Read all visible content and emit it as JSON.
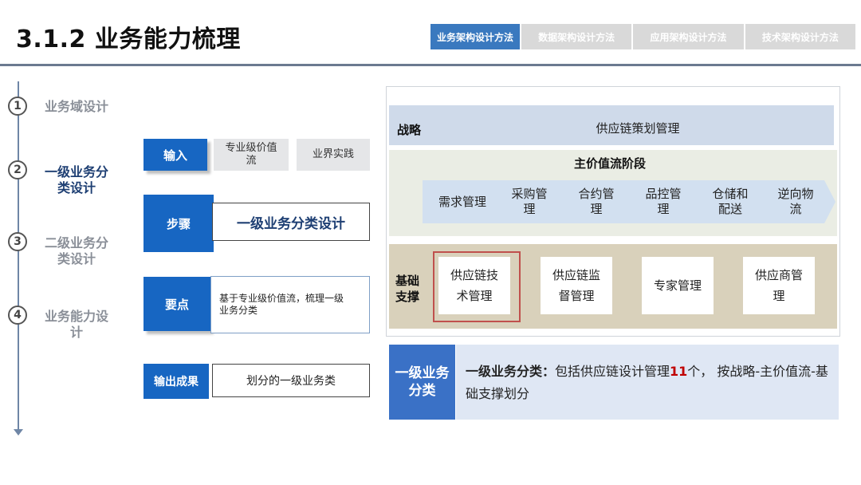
{
  "header": {
    "title": "3.1.2 业务能力梳理",
    "tabs": [
      "业务架构设计方法",
      "数据架构设计方法",
      "应用架构设计方法",
      "技术架构设计方法"
    ],
    "active_tab": 0
  },
  "timeline": {
    "steps": [
      {
        "num": "1",
        "label_l1": "业务域设计",
        "label_l2": ""
      },
      {
        "num": "2",
        "label_l1": "一级业务分",
        "label_l2": "类设计"
      },
      {
        "num": "3",
        "label_l1": "二级业务分",
        "label_l2": "类设计"
      },
      {
        "num": "4",
        "label_l1": "业务能力设",
        "label_l2": "计"
      }
    ],
    "active_step": 1
  },
  "process": {
    "input_label": "输入",
    "input_items": [
      {
        "l1": "专业级价值",
        "l2": "流"
      },
      {
        "l1": "业界实践",
        "l2": ""
      }
    ],
    "step_label": "步骤",
    "step_value": "一级业务分类设计",
    "keypoint_label": "要点",
    "keypoint_l1": "基于专业级价值流，梳理一级",
    "keypoint_l2": "业务分类",
    "output_label": "输出成果",
    "output_value": "划分的一级业务类"
  },
  "diagram": {
    "strategy_label": "战略",
    "strategy_text": "供应链策划管理",
    "value_stream_title": "主价值流阶段",
    "value_stream": [
      {
        "l1": "需求管理",
        "l2": ""
      },
      {
        "l1": "采购管",
        "l2": "理"
      },
      {
        "l1": "合约管",
        "l2": "理"
      },
      {
        "l1": "品控管",
        "l2": "理"
      },
      {
        "l1": "仓储和",
        "l2": "配送"
      },
      {
        "l1": "逆向物",
        "l2": "流"
      }
    ],
    "base_label": "基础支撑",
    "base_items": [
      {
        "l1": "供应链技",
        "l2": "术管理"
      },
      {
        "l1": "供应链监",
        "l2": "督管理"
      },
      {
        "l1": "专家管理",
        "l2": ""
      },
      {
        "l1": "供应商管",
        "l2": "理"
      }
    ]
  },
  "summary": {
    "label": "一级业务分类",
    "bold": "一级业务分类：",
    "text_before": "包括供应链设计管理",
    "count": "11",
    "text_after": "个， 按战略-主价值流-基础支撑划分"
  },
  "colors": {
    "brand_blue": "#1766c2",
    "highlight_red": "#c00000",
    "active_tab": "#3a79bf"
  }
}
